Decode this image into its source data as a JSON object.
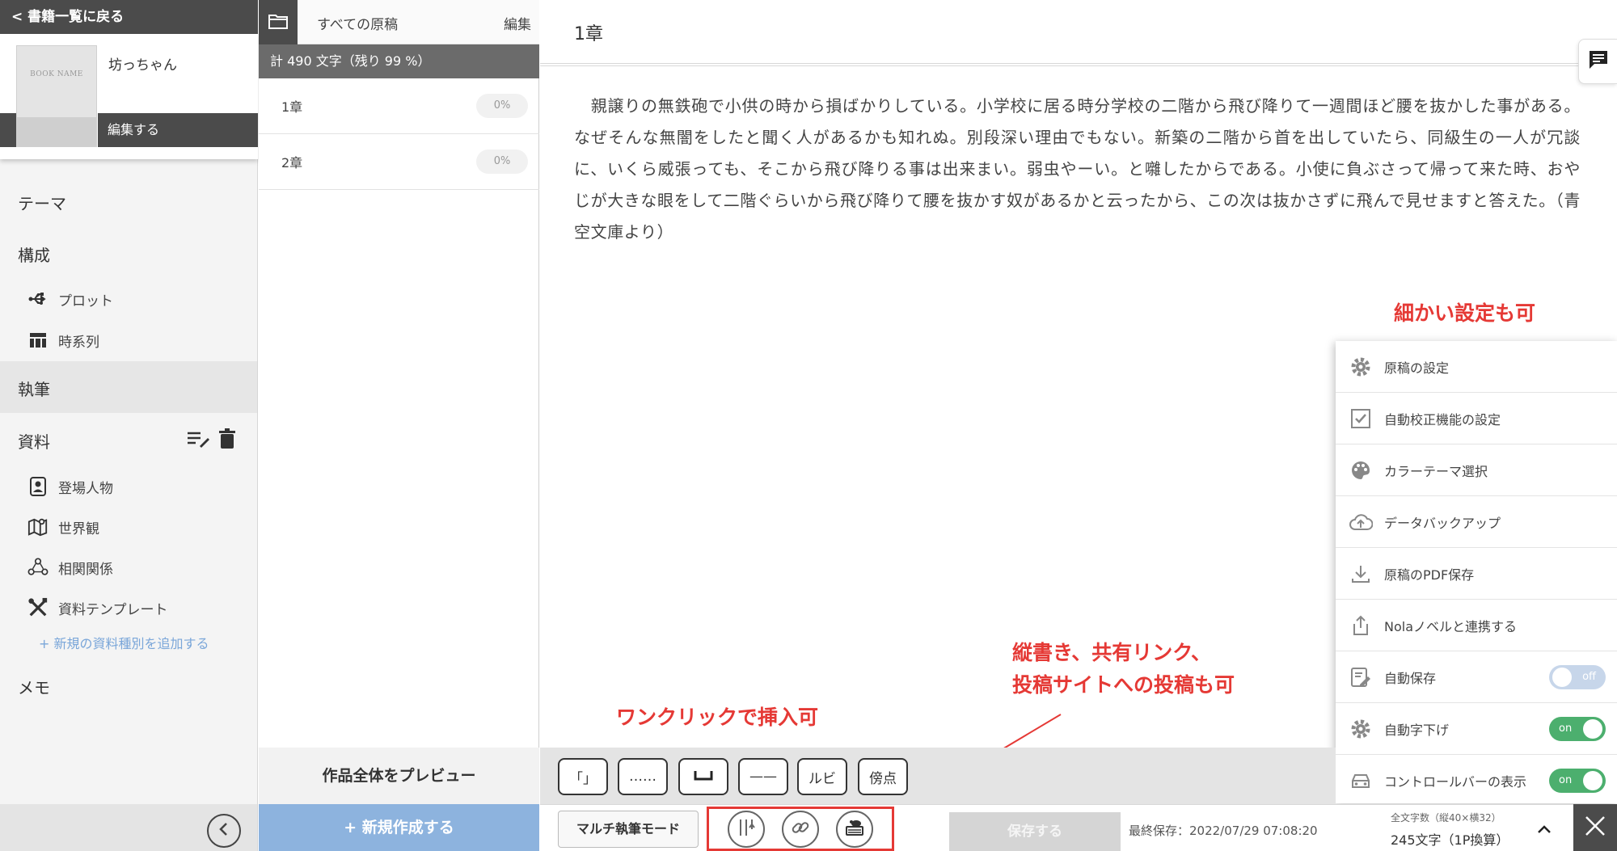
{
  "sidebar": {
    "back_label": "< 書籍一覧に戻る",
    "book": {
      "cover_label": "BOOK NAME",
      "title": "坊っちゃん",
      "edit_label": "編集する"
    },
    "theme": "テーマ",
    "structure": "構成",
    "plot": "プロット",
    "timeline": "時系列",
    "writing": "執筆",
    "materials": "資料",
    "characters": "登場人物",
    "world": "世界観",
    "relations": "相関関係",
    "template": "資料テンプレート",
    "add_type": "+ 新規の資料種別を追加する",
    "memo": "メモ"
  },
  "manuscripts": {
    "all_label": "すべての原稿",
    "edit_label": "編集",
    "count": "計 490 文字（残り 99 %）",
    "chapters": [
      {
        "name": "1章",
        "progress": "0%"
      },
      {
        "name": "2章",
        "progress": "0%"
      }
    ],
    "preview_label": "作品全体をプレビュー",
    "new_label": "+ 新規作成する"
  },
  "editor": {
    "title": "1章",
    "body": "　親譲りの無鉄砲で小供の時から損ばかりしている。小学校に居る時分学校の二階から飛び降りて一週間ほど腰を抜かした事がある。なぜそんな無闇をしたと聞く人があるかも知れぬ。別段深い理由でもない。新築の二階から首を出していたら、同級生の一人が冗談に、いくら威張っても、そこから飛び降りる事は出来まい。弱虫やーい。と囃したからである。小使に負ぶさって帰って来た時、おやじが大きな眼をして二階ぐらいから飛び降りて腰を抜かす奴があるかと云ったから、この次は抜かさずに飛んで見せますと答えた。（青空文庫より）"
  },
  "annotations": {
    "settings_note": "細かい設定も可",
    "share_note_line1": "縦書き、共有リンク、",
    "share_note_line2": "投稿サイトへの投稿も可",
    "insert_note": "ワンクリックで挿入可"
  },
  "settings_menu": {
    "items": [
      {
        "label": "原稿の設定",
        "icon": "gear-icon"
      },
      {
        "label": "自動校正機能の設定",
        "icon": "checkbox-icon"
      },
      {
        "label": "カラーテーマ選択",
        "icon": "palette-icon"
      },
      {
        "label": "データバックアップ",
        "icon": "cloud-upload-icon"
      },
      {
        "label": "原稿のPDF保存",
        "icon": "download-icon"
      },
      {
        "label": "Nolaノベルと連携する",
        "icon": "share-icon"
      },
      {
        "label": "自動保存",
        "icon": "edit-note-icon",
        "toggle": "off"
      },
      {
        "label": "自動字下げ",
        "icon": "gear-icon",
        "toggle": "on"
      },
      {
        "label": "コントロールバーの表示",
        "icon": "car-icon",
        "toggle": "on"
      }
    ]
  },
  "insert_toolbar": {
    "buttons": [
      "「」",
      "……",
      "␣",
      "——",
      "ルビ",
      "傍点"
    ]
  },
  "bottom_bar": {
    "multi_mode": "マルチ執筆モード",
    "save_label": "保存する",
    "last_saved": "最終保存：2022/07/29 07:08:20",
    "wordcount_label": "全文字数（縦40×横32）",
    "wordcount_value": "245文字（1P換算）"
  },
  "colors": {
    "annotation_red": "#e53935",
    "accent_blue": "#8db3de",
    "toggle_green": "#4caf6e",
    "dark_gray": "#4b4b4b"
  }
}
